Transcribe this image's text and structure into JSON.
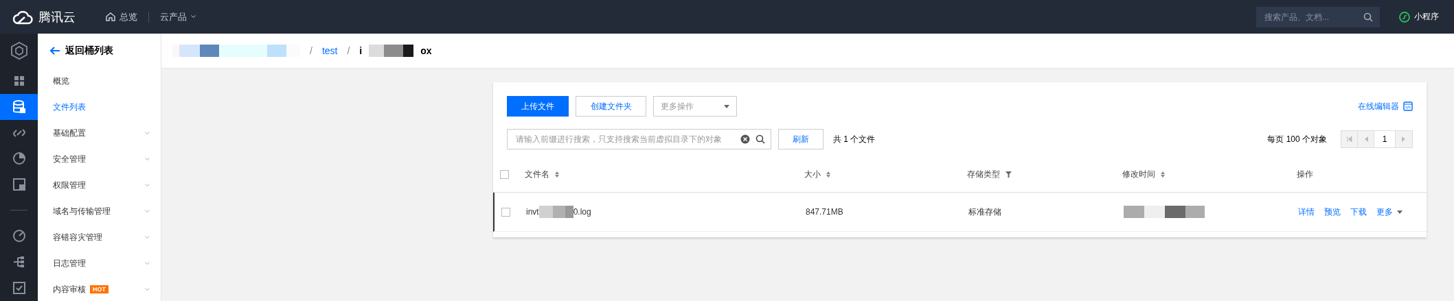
{
  "top_bar": {
    "brand": "腾讯云",
    "nav": [
      {
        "kind": "home",
        "label": "总览"
      },
      {
        "kind": "dropdown",
        "label": "云产品"
      }
    ],
    "search": {
      "placeholder": "搜索产品、文档..."
    },
    "mini_program": "小程序"
  },
  "icon_rail": [
    {
      "kind": "cube"
    },
    {
      "kind": "grid",
      "selected": false
    },
    {
      "kind": "database",
      "selected": true
    },
    {
      "kind": "link",
      "selected": false
    },
    {
      "kind": "pie",
      "selected": false
    },
    {
      "kind": "box",
      "selected": false
    },
    {
      "kind": "divider"
    },
    {
      "kind": "gauge",
      "selected": false
    },
    {
      "kind": "tree",
      "selected": false
    },
    {
      "kind": "check",
      "selected": false
    }
  ],
  "sidebar": {
    "back": "返回桶列表",
    "items": [
      {
        "label": "概览",
        "selected": false,
        "expandable": false
      },
      {
        "label": "文件列表",
        "selected": true,
        "expandable": false
      },
      {
        "label": "基础配置",
        "selected": false,
        "expandable": true
      },
      {
        "label": "安全管理",
        "selected": false,
        "expandable": true
      },
      {
        "label": "权限管理",
        "selected": false,
        "expandable": true
      },
      {
        "label": "域名与传输管理",
        "selected": false,
        "expandable": true
      },
      {
        "label": "容错容灾管理",
        "selected": false,
        "expandable": true
      },
      {
        "label": "日志管理",
        "selected": false,
        "expandable": true
      },
      {
        "label": "内容审核",
        "selected": false,
        "expandable": true,
        "badge": "HOT"
      }
    ]
  },
  "breadcrumb": [
    {
      "kind": "redacted"
    },
    {
      "kind": "link",
      "separator": "/",
      "label": "test"
    },
    {
      "kind": "current",
      "separator": "/",
      "prefix": "i",
      "suffix": "ox"
    }
  ],
  "toolbar": {
    "buttons": [
      {
        "kind": "primary",
        "label": "上传文件"
      },
      {
        "kind": "secondary",
        "label": "创建文件夹"
      }
    ],
    "more_actions": {
      "placeholder": "更多操作"
    },
    "editor_link": "在线编辑器",
    "search": {
      "placeholder": "请输入前缀进行搜索，只支持搜索当前虚拟目录下的对象"
    },
    "refresh": "刷新",
    "count": "共 1 个文件",
    "per_page": "每页 100 个对象",
    "page": "1"
  },
  "table": {
    "select_all": {
      "checked": false
    },
    "columns": [
      {
        "label": "文件名",
        "kind": "sort"
      },
      {
        "label": "大小",
        "kind": "sort"
      },
      {
        "label": "存储类型",
        "kind": "filter"
      },
      {
        "label": "修改时间",
        "kind": "sort"
      },
      {
        "label": "操作",
        "kind": "plain"
      }
    ],
    "rows": [
      {
        "checked": false,
        "highlighted": true,
        "name_prefix": "invt",
        "name_suffix": "0.log",
        "size": "847.71MB",
        "storage_class": "标准存储",
        "actions": [
          {
            "label": "详情",
            "dropdown": false
          },
          {
            "label": "预览",
            "dropdown": false
          },
          {
            "label": "下载",
            "dropdown": false
          },
          {
            "label": "更多",
            "dropdown": true
          }
        ]
      }
    ]
  }
}
